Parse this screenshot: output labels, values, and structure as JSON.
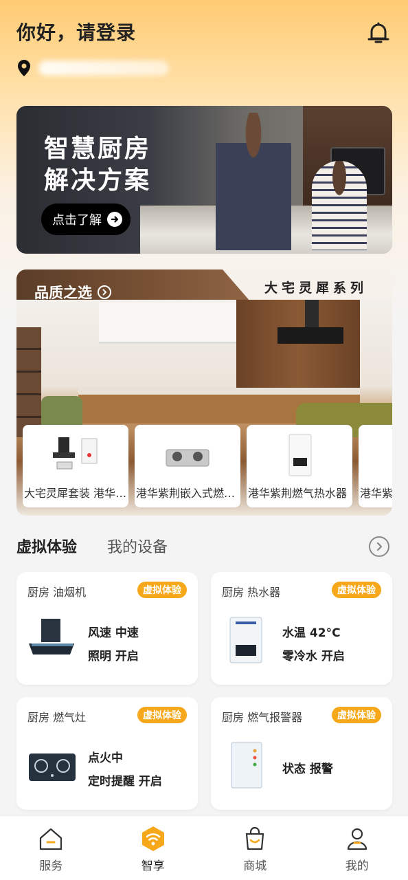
{
  "header": {
    "greeting": "你好，请登录"
  },
  "banner": {
    "title_line1": "智慧厨房",
    "title_line2": "解决方案",
    "cta_label": "点击了解"
  },
  "quality": {
    "tab_title": "品质之选",
    "series_title": "大宅灵犀系列",
    "products": [
      {
        "name": "大宅灵犀套装 港华紫荆"
      },
      {
        "name": "港华紫荆嵌入式燃气灶"
      },
      {
        "name": "港华紫荆燃气热水器"
      },
      {
        "name": "港华紫"
      }
    ]
  },
  "section_tabs": {
    "active": "虚拟体验",
    "inactive": "我的设备"
  },
  "devices": [
    {
      "location": "厨房  油烟机",
      "badge": "虚拟体验",
      "stat1": "风速  中速",
      "stat2": "照明  开启"
    },
    {
      "location": "厨房  热水器",
      "badge": "虚拟体验",
      "stat1": "水温  42°C",
      "stat2": "零冷水  开启"
    },
    {
      "location": "厨房  燃气灶",
      "badge": "虚拟体验",
      "stat1": "点火中",
      "stat2": "定时提醒  开启"
    },
    {
      "location": "厨房  燃气报警器",
      "badge": "虚拟体验",
      "stat": "状态  报警"
    }
  ],
  "bottom_nav": [
    {
      "label": "服务",
      "icon": "house-icon",
      "active": false
    },
    {
      "label": "智享",
      "icon": "wifi-hexagon-icon",
      "active": true
    },
    {
      "label": "商城",
      "icon": "shopping-bag-icon",
      "active": false
    },
    {
      "label": "我的",
      "icon": "user-icon",
      "active": false
    }
  ],
  "colors": {
    "accent": "#f6a81a",
    "header_gradient_top": "#ffcb73"
  }
}
